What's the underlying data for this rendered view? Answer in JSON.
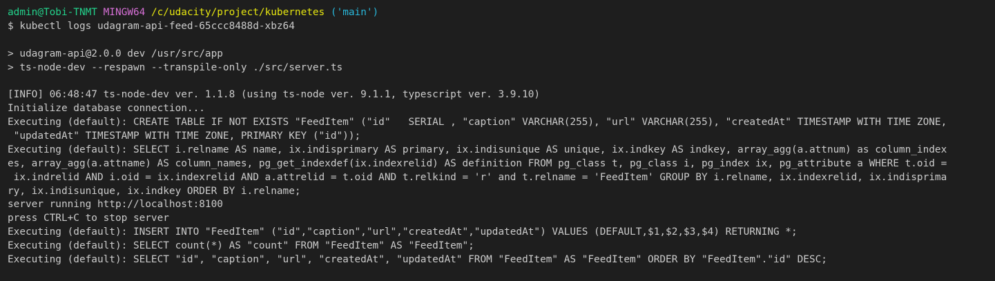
{
  "prompt": {
    "user_host": "admin@Tobi-TNMT",
    "system": "MINGW64",
    "path": "/c/udacity/project/kubernetes",
    "branch": "('main')",
    "colors": {
      "user_host": "#23d18b",
      "system": "#d670d6",
      "path": "#e5e510",
      "branch": "#29b8db",
      "text": "#cccccc",
      "background": "#1e1e1e"
    }
  },
  "command": "$ kubectl logs udagram-api-feed-65ccc8488d-xbz64",
  "output": [
    "",
    "> udagram-api@2.0.0 dev /usr/src/app",
    "> ts-node-dev --respawn --transpile-only ./src/server.ts",
    "",
    "[INFO] 06:48:47 ts-node-dev ver. 1.1.8 (using ts-node ver. 9.1.1, typescript ver. 3.9.10)",
    "Initialize database connection...",
    "Executing (default): CREATE TABLE IF NOT EXISTS \"FeedItem\" (\"id\"   SERIAL , \"caption\" VARCHAR(255), \"url\" VARCHAR(255), \"createdAt\" TIMESTAMP WITH TIME ZONE,",
    " \"updatedAt\" TIMESTAMP WITH TIME ZONE, PRIMARY KEY (\"id\"));",
    "Executing (default): SELECT i.relname AS name, ix.indisprimary AS primary, ix.indisunique AS unique, ix.indkey AS indkey, array_agg(a.attnum) as column_index",
    "es, array_agg(a.attname) AS column_names, pg_get_indexdef(ix.indexrelid) AS definition FROM pg_class t, pg_class i, pg_index ix, pg_attribute a WHERE t.oid =",
    " ix.indrelid AND i.oid = ix.indexrelid AND a.attrelid = t.oid AND t.relkind = 'r' and t.relname = 'FeedItem' GROUP BY i.relname, ix.indexrelid, ix.indisprima",
    "ry, ix.indisunique, ix.indkey ORDER BY i.relname;",
    "server running http://localhost:8100",
    "press CTRL+C to stop server",
    "Executing (default): INSERT INTO \"FeedItem\" (\"id\",\"caption\",\"url\",\"createdAt\",\"updatedAt\") VALUES (DEFAULT,$1,$2,$3,$4) RETURNING *;",
    "Executing (default): SELECT count(*) AS \"count\" FROM \"FeedItem\" AS \"FeedItem\";",
    "Executing (default): SELECT \"id\", \"caption\", \"url\", \"createdAt\", \"updatedAt\" FROM \"FeedItem\" AS \"FeedItem\" ORDER BY \"FeedItem\".\"id\" DESC;"
  ]
}
